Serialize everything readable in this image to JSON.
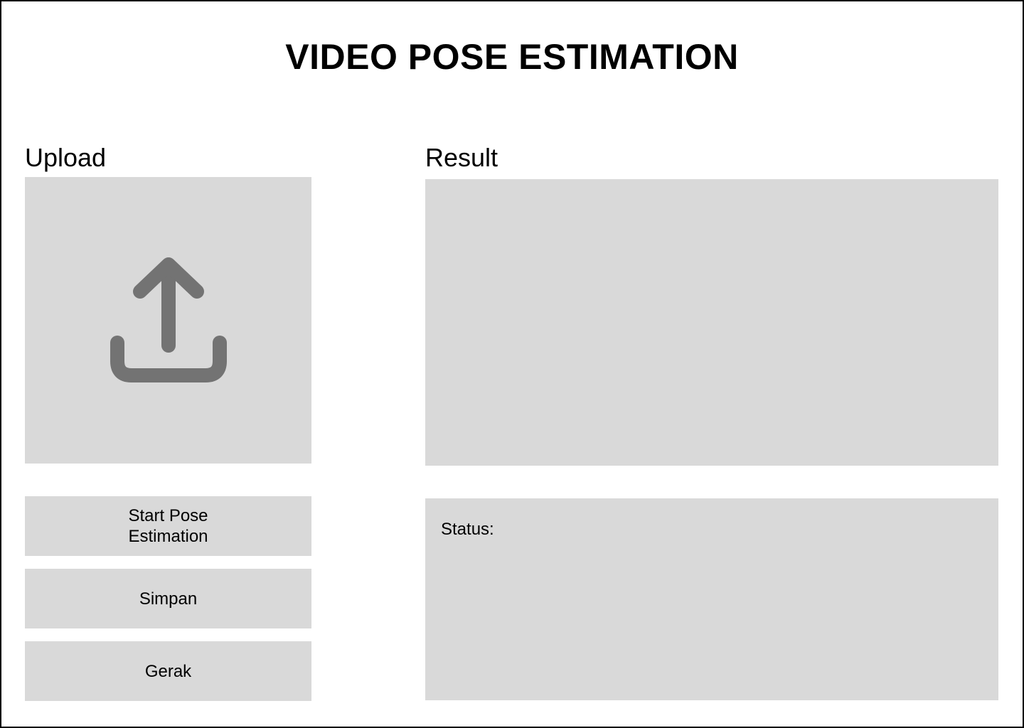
{
  "page": {
    "title": "VIDEO POSE ESTIMATION"
  },
  "upload": {
    "label": "Upload",
    "icon": "upload-icon"
  },
  "result": {
    "label": "Result"
  },
  "buttons": {
    "start_label": "Start Pose Estimation",
    "save_label": "Simpan",
    "move_label": "Gerak"
  },
  "status": {
    "label": "Status:"
  },
  "colors": {
    "panel": "#d9d9d9",
    "icon": "#737373",
    "border": "#000000",
    "background": "#ffffff"
  }
}
